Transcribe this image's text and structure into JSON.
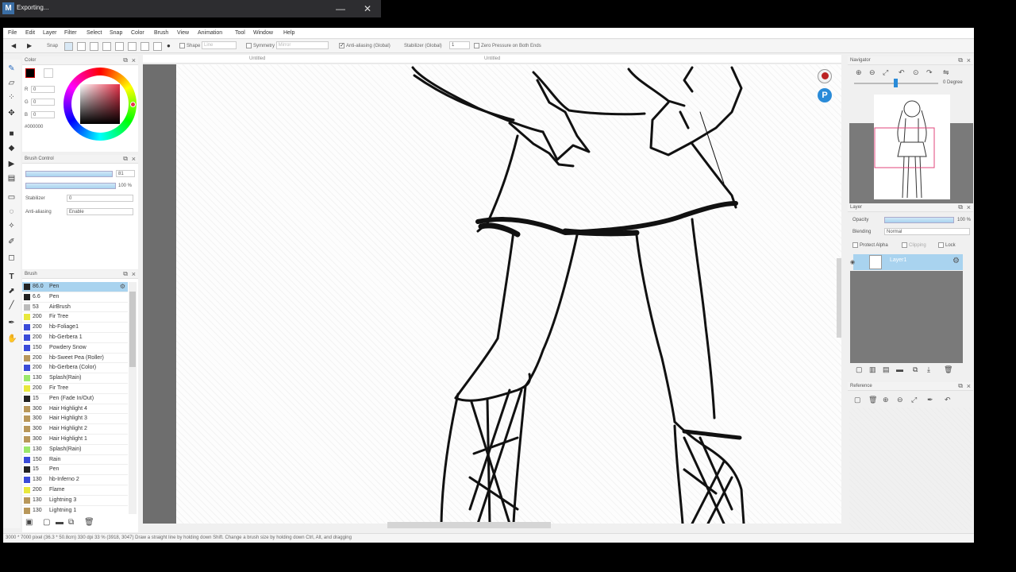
{
  "window": {
    "title": "Exporting...",
    "minimize": "—",
    "close": "✕"
  },
  "menu": [
    "File",
    "Edit",
    "Layer",
    "Filter",
    "Select",
    "Snap",
    "Color",
    "Brush",
    "View",
    "Animation",
    "Tool",
    "Window",
    "Help"
  ],
  "toolbar": {
    "snap_label": "Snap",
    "shape_label": "Shape",
    "shape_value": "Line",
    "symmetry_label": "Symmetry",
    "symmetry_value": "Mirror",
    "antialias_label": "Anti-aliasing (Global)",
    "stabilizer_label": "Stabilizer (Global)",
    "stabilizer_value": "1",
    "zero_pressure_label": "Zero Pressure on Both Ends"
  },
  "tabs": [
    "Untitled",
    "Untitled"
  ],
  "color_panel": {
    "title": "Color",
    "r": "0",
    "g": "0",
    "b": "0",
    "hex": "#000000",
    "current_color": "#000000"
  },
  "brush_control": {
    "title": "Brush Control",
    "size_value": "81",
    "opacity_value": "100 %",
    "stabilizer_label": "Stabilizer",
    "stabilizer_value": "0",
    "antialias_label": "Anti-aliasing",
    "antialias_value": "Enable"
  },
  "brush_panel": {
    "title": "Brush",
    "items": [
      {
        "color": "#222222",
        "size": "86.0",
        "name": "Pen"
      },
      {
        "color": "#222222",
        "size": "6.6",
        "name": "Pen"
      },
      {
        "color": "#bbbbbb",
        "size": "53",
        "name": "AirBrush"
      },
      {
        "color": "#e8e83c",
        "size": "200",
        "name": "Fir Tree"
      },
      {
        "color": "#3a4bd8",
        "size": "200",
        "name": "hb-Foliage1"
      },
      {
        "color": "#3a4bd8",
        "size": "200",
        "name": "hb-Gerbera 1"
      },
      {
        "color": "#3a4bd8",
        "size": "150",
        "name": "Powdery Snow"
      },
      {
        "color": "#b8975a",
        "size": "200",
        "name": "hb-Sweet Pea (Roller)"
      },
      {
        "color": "#3a4bd8",
        "size": "200",
        "name": "hb-Gerbera (Color)"
      },
      {
        "color": "#9be86b",
        "size": "130",
        "name": "Splash(Rain)"
      },
      {
        "color": "#e8e83c",
        "size": "200",
        "name": "Fir Tree"
      },
      {
        "color": "#222222",
        "size": "15",
        "name": "Pen (Fade In/Out)"
      },
      {
        "color": "#b8975a",
        "size": "300",
        "name": "Hair Highlight 4"
      },
      {
        "color": "#b8975a",
        "size": "300",
        "name": "Hair Highlight 3"
      },
      {
        "color": "#b8975a",
        "size": "300",
        "name": "Hair Highlight 2"
      },
      {
        "color": "#b8975a",
        "size": "300",
        "name": "Hair Highlight 1"
      },
      {
        "color": "#9be86b",
        "size": "130",
        "name": "Splash(Rain)"
      },
      {
        "color": "#3a4bd8",
        "size": "150",
        "name": "Rain"
      },
      {
        "color": "#222222",
        "size": "15",
        "name": "Pen"
      },
      {
        "color": "#3a4bd8",
        "size": "130",
        "name": "hb-Inferno 2"
      },
      {
        "color": "#e8e83c",
        "size": "200",
        "name": "Flame"
      },
      {
        "color": "#b8975a",
        "size": "130",
        "name": "Lightning 3"
      },
      {
        "color": "#b8975a",
        "size": "130",
        "name": "Lightning 1"
      }
    ]
  },
  "navigator": {
    "title": "Navigator",
    "degree": "0 Degree"
  },
  "layer_panel": {
    "title": "Layer",
    "opacity_label": "Opacity",
    "opacity_value": "100 %",
    "blending_label": "Blending",
    "blending_value": "Normal",
    "protect_alpha": "Protect Alpha",
    "clipping": "Clipping",
    "lock": "Lock",
    "layer_name": "Layer1"
  },
  "reference_panel": {
    "title": "Reference"
  },
  "status": "3000 * 7000 pixel  (36.3 * 50.8cm)  330 dpi  33 %  (3918, 3047)  Draw a straight line by holding down Shift. Change a brush size by holding down Ctrl, Alt, and dragging"
}
